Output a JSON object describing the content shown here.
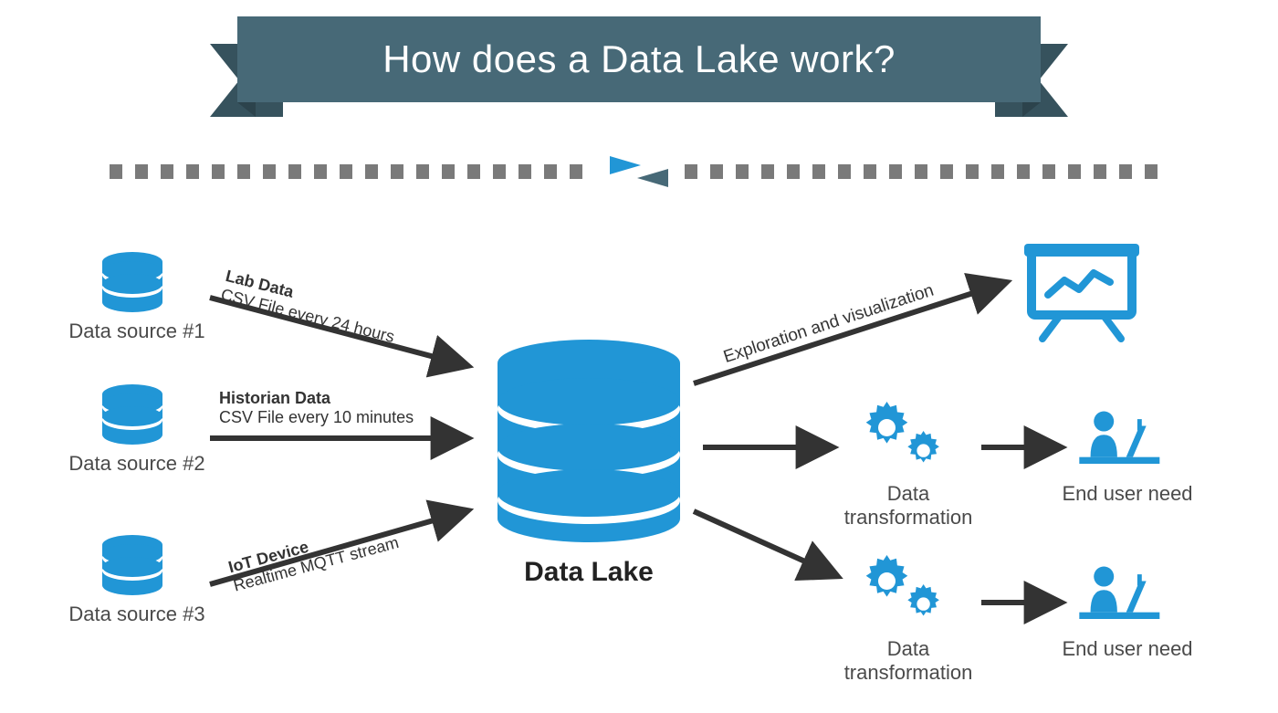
{
  "title": "How does a Data Lake work?",
  "sources": [
    {
      "label": "Data source #1",
      "arrow_title": "Lab Data",
      "arrow_sub": "CSV File every 24 hours"
    },
    {
      "label": "Data source #2",
      "arrow_title": "Historian Data",
      "arrow_sub": "CSV File every 10 minutes"
    },
    {
      "label": "Data source #3",
      "arrow_title": "IoT Device",
      "arrow_sub": "Realtime MQTT stream"
    }
  ],
  "center": {
    "label": "Data Lake"
  },
  "outputs": {
    "exploration_label": "Exploration and visualization",
    "transform1_label": "Data transformation",
    "enduser1_label": "End user need",
    "transform2_label": "Data transformation",
    "enduser2_label": "End user need"
  },
  "colors": {
    "accent": "#2196d6",
    "banner": "#476977",
    "dark": "#333333"
  }
}
